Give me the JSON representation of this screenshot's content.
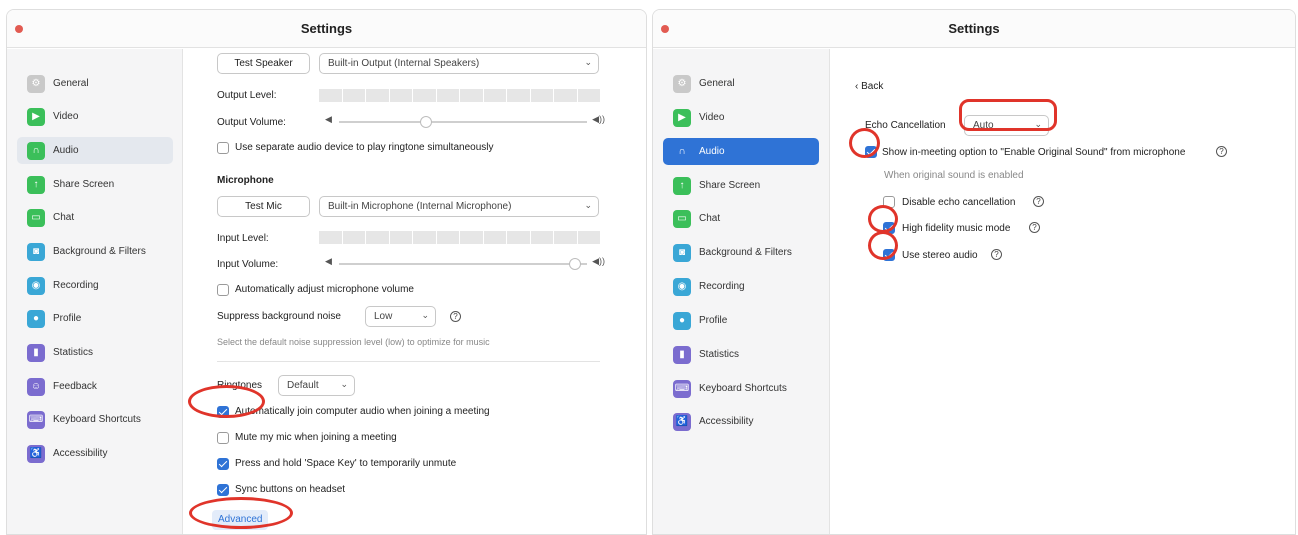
{
  "left": {
    "title": "Settings",
    "sidebar": [
      "General",
      "Video",
      "Audio",
      "Share Screen",
      "Chat",
      "Background & Filters",
      "Recording",
      "Profile",
      "Statistics",
      "Feedback",
      "Keyboard Shortcuts",
      "Accessibility"
    ],
    "speaker": {
      "test_button": "Test Speaker",
      "device": "Built-in Output (Internal Speakers)",
      "output_level": "Output Level:",
      "output_volume": "Output Volume:",
      "volume_level": 0.35
    },
    "separate_ringtone": {
      "label": "Use separate audio device to play ringtone simultaneously",
      "checked": false
    },
    "microphone": {
      "heading": "Microphone",
      "test_button": "Test Mic",
      "device": "Built-in Microphone (Internal Microphone)",
      "input_level": "Input Level:",
      "input_volume": "Input Volume:",
      "volume_level": 0.95
    },
    "auto_adjust": {
      "label": "Automatically adjust microphone volume",
      "checked": false
    },
    "suppress": {
      "label": "Suppress background noise",
      "value": "Low",
      "hint": "Select the default noise suppression level (low) to optimize for music"
    },
    "ringtones": {
      "label": "Ringtones",
      "value": "Default"
    },
    "auto_join": {
      "label": "Automatically join computer audio when joining a meeting",
      "checked": true
    },
    "mute_mic": {
      "label": "Mute my mic when joining a meeting",
      "checked": false
    },
    "space_key": {
      "label": "Press and hold 'Space Key' to temporarily unmute",
      "checked": true
    },
    "sync_headset": {
      "label": "Sync buttons on headset",
      "checked": true
    },
    "advanced": "Advanced"
  },
  "right": {
    "title": "Settings",
    "sidebar": [
      "General",
      "Video",
      "Audio",
      "Share Screen",
      "Chat",
      "Background & Filters",
      "Recording",
      "Profile",
      "Statistics",
      "Keyboard Shortcuts",
      "Accessibility"
    ],
    "back": "Back",
    "echo": {
      "label": "Echo Cancellation",
      "value": "Auto"
    },
    "original_sound": {
      "label": "Show in-meeting option to \"Enable Original Sound\" from microphone",
      "checked": true
    },
    "when_enabled": "When original sound is enabled",
    "disable_echo": {
      "label": "Disable echo cancellation",
      "checked": false
    },
    "hifi": {
      "label": "High fidelity music mode",
      "checked": true
    },
    "stereo": {
      "label": "Use stereo audio",
      "checked": true
    }
  },
  "colors": {
    "accent": "#2f73d6",
    "annotation": "#e0342a"
  }
}
